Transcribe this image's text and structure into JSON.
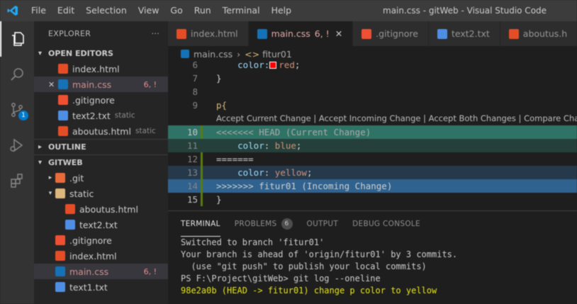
{
  "titlebar": {
    "menu": [
      "File",
      "Edit",
      "Selection",
      "View",
      "Go",
      "Run",
      "Terminal",
      "Help"
    ],
    "title": "main.css - gitWeb - Visual Studio Code"
  },
  "activity": {
    "icons": [
      "explorer-icon",
      "search-icon",
      "source-control-icon",
      "run-debug-icon",
      "extensions-icon"
    ],
    "scm_badge": "1"
  },
  "sidebar": {
    "title": "EXPLORER",
    "more": "···",
    "open_editors": {
      "label": "OPEN EDITORS",
      "items": [
        {
          "name": "index.html",
          "desc": "",
          "badge": ""
        },
        {
          "name": "main.css",
          "desc": "",
          "badge": "6, !"
        },
        {
          "name": ".gitignore",
          "desc": "",
          "badge": ""
        },
        {
          "name": "text2.txt",
          "desc": "static",
          "badge": ""
        },
        {
          "name": "aboutus.html",
          "desc": "static",
          "badge": ""
        }
      ]
    },
    "outline": {
      "label": "OUTLINE"
    },
    "workspace": {
      "label": "GITWEB",
      "items": [
        {
          "name": ".git",
          "badge": ""
        },
        {
          "name": "static",
          "badge": ""
        },
        {
          "name": "aboutus.html",
          "badge": ""
        },
        {
          "name": "text2.txt",
          "badge": ""
        },
        {
          "name": ".gitignore",
          "badge": ""
        },
        {
          "name": "index.html",
          "badge": ""
        },
        {
          "name": "main.css",
          "badge": "6, !"
        },
        {
          "name": "text1.txt",
          "badge": ""
        }
      ]
    }
  },
  "tabs": [
    {
      "label": "index.html",
      "badge": "",
      "active": false
    },
    {
      "label": "main.css",
      "badge": "6, !",
      "active": true
    },
    {
      "label": ".gitignore",
      "badge": "",
      "active": false
    },
    {
      "label": "text2.txt",
      "badge": "",
      "active": false
    },
    {
      "label": "aboutus.h",
      "badge": "",
      "active": false
    }
  ],
  "breadcrumb": {
    "file": "main.css",
    "symbol": "fitur01"
  },
  "editor": {
    "codelens": "Accept Current Change | Accept Incoming Change | Accept Both Changes | Compare Changes",
    "lines": [
      {
        "num": "6",
        "text": "    color: red;"
      },
      {
        "num": "7",
        "text": "}"
      },
      {
        "num": "8",
        "text": ""
      },
      {
        "num": "9",
        "text": "p{"
      },
      {
        "num": "10",
        "text": "<<<<<<< HEAD (Current Change)"
      },
      {
        "num": "11",
        "text": "    color: blue;"
      },
      {
        "num": "12",
        "text": "======="
      },
      {
        "num": "13",
        "text": "    color: yellow;"
      },
      {
        "num": "14",
        "text": ">>>>>>> fitur01 (Incoming Change)"
      },
      {
        "num": "15",
        "text": "}"
      }
    ]
  },
  "panel": {
    "tabs": [
      "TERMINAL",
      "PROBLEMS",
      "OUTPUT",
      "DEBUG CONSOLE"
    ],
    "problems_count": "6",
    "terminal": [
      "Switched to branch 'fitur01'",
      "Your branch is ahead of 'origin/fitur01' by 3 commits.",
      "  (use \"git push\" to publish your local commits)",
      "PS F:\\Project\\gitWeb> git log --oneline",
      "98e2a0b (HEAD -> fitur01) change p color to yellow"
    ]
  }
}
